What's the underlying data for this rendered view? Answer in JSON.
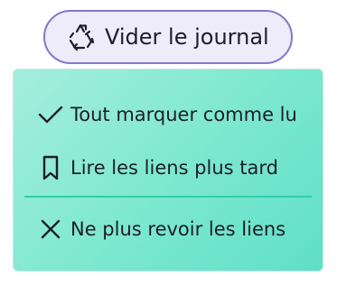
{
  "clear_button": {
    "label": "Vider le journal",
    "icon": "recycle-icon"
  },
  "menu": {
    "items": [
      {
        "label": "Tout marquer comme lu",
        "icon": "check-icon"
      },
      {
        "label": "Lire les liens plus tard",
        "icon": "bookmark-icon"
      },
      {
        "label": "Ne plus revoir les liens",
        "icon": "close-icon"
      }
    ]
  },
  "colors": {
    "button_border": "#8576cc",
    "button_bg": "#eeebfa",
    "menu_bg_start": "#a4eedd",
    "menu_bg_end": "#5fe0c6",
    "divider": "#2fcfa9",
    "text": "#1d1d2b"
  }
}
